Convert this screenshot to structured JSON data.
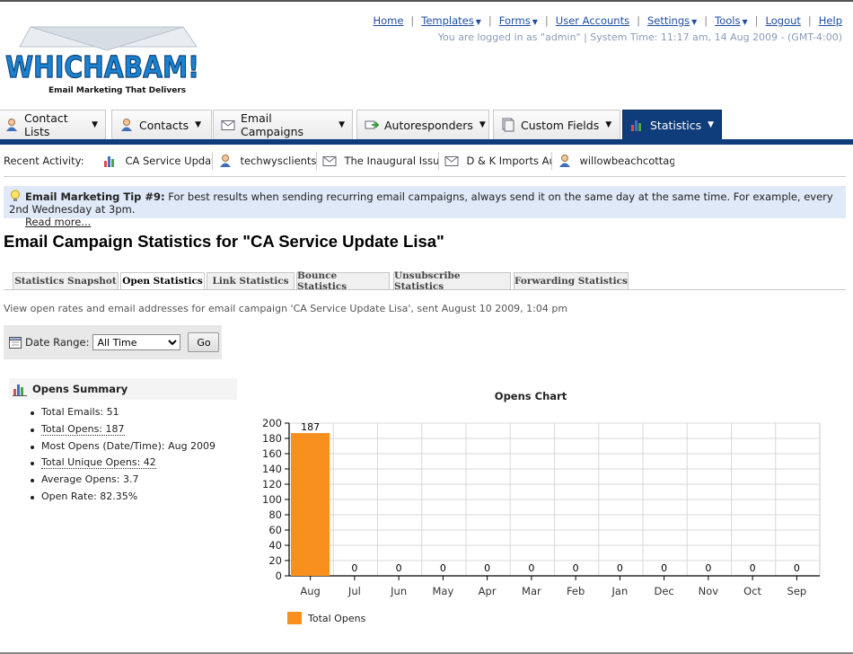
{
  "header": {
    "logo_text": "WHICHABAM!",
    "logo_tagline": "Email Marketing That Delivers",
    "links": [
      {
        "label": "Home",
        "dropdown": false
      },
      {
        "label": "Templates",
        "dropdown": true
      },
      {
        "label": "Forms",
        "dropdown": true
      },
      {
        "label": "User Accounts",
        "dropdown": false
      },
      {
        "label": "Settings",
        "dropdown": true
      },
      {
        "label": "Tools",
        "dropdown": true
      },
      {
        "label": "Logout",
        "dropdown": false
      },
      {
        "label": "Help",
        "dropdown": false
      }
    ],
    "login_info": "You are logged in as \"admin\" | System Time: 11:17 am, 14 Aug 2009 - (GMT-4:00)"
  },
  "nav": {
    "tabs": [
      {
        "label": "Contact Lists",
        "icon": "contact-lists-icon",
        "active": false
      },
      {
        "label": "Contacts",
        "icon": "contacts-icon",
        "active": false
      },
      {
        "label": "Email Campaigns",
        "icon": "envelope-icon",
        "active": false
      },
      {
        "label": "Autoresponders",
        "icon": "autoresponder-icon",
        "active": false
      },
      {
        "label": "Custom Fields",
        "icon": "custom-fields-icon",
        "active": false
      },
      {
        "label": "Statistics",
        "icon": "bar-chart-icon",
        "active": true
      }
    ]
  },
  "recent": {
    "label": "Recent Activity:",
    "items": [
      {
        "label": "CA Service Update .",
        "icon": "bar-chart-icon"
      },
      {
        "label": "techwysclients",
        "icon": "user-icon"
      },
      {
        "label": "The Inaugural Issue",
        "icon": "envelope-icon"
      },
      {
        "label": "D & K Imports Augu",
        "icon": "envelope-icon"
      },
      {
        "label": "willowbeachcottage",
        "icon": "user-icon"
      }
    ]
  },
  "tip": {
    "title": "Email Marketing Tip #9:",
    "text": "For best results when sending recurring email campaigns, always send it on the same day at the same time. For example, every 2nd Wednesday at 3pm.",
    "link": "Read more..."
  },
  "page_title": "Email Campaign Statistics for \"CA Service Update Lisa\"",
  "subtabs": [
    {
      "label": "Statistics Snapshot",
      "active": false
    },
    {
      "label": "Open Statistics",
      "active": true
    },
    {
      "label": "Link Statistics",
      "active": false
    },
    {
      "label": "Bounce Statistics",
      "active": false
    },
    {
      "label": "Unsubscribe Statistics",
      "active": false
    },
    {
      "label": "Forwarding Statistics",
      "active": false
    }
  ],
  "description": "View open rates and email addresses for email campaign 'CA Service Update Lisa', sent August 10 2009, 1:04 pm",
  "date_range": {
    "label": "Date Range:",
    "selected": "All Time",
    "go_label": "Go"
  },
  "summary": {
    "title": "Opens Summary",
    "items": [
      {
        "label": "Total Emails: 51",
        "link": false
      },
      {
        "label": "Total Opens: 187",
        "link": true
      },
      {
        "label": "Most Opens (Date/Time): Aug 2009",
        "link": false
      },
      {
        "label": "Total Unique Opens: 42",
        "link": true
      },
      {
        "label": "Average Opens: 3.7",
        "link": false
      },
      {
        "label": "Open Rate: 82.35%",
        "link": false
      }
    ]
  },
  "chart_data": {
    "type": "bar",
    "title": "Opens Chart",
    "categories": [
      "Aug",
      "Jul",
      "Jun",
      "May",
      "Apr",
      "Mar",
      "Feb",
      "Jan",
      "Dec",
      "Nov",
      "Oct",
      "Sep"
    ],
    "series": [
      {
        "name": "Total Opens",
        "values": [
          187,
          0,
          0,
          0,
          0,
          0,
          0,
          0,
          0,
          0,
          0,
          0
        ]
      }
    ],
    "ylim": [
      0,
      200
    ],
    "yticks": [
      0,
      20,
      40,
      60,
      80,
      100,
      120,
      140,
      160,
      180,
      200
    ],
    "grid": true,
    "legend": "bottom-left",
    "bar_color": "#f7901e"
  }
}
